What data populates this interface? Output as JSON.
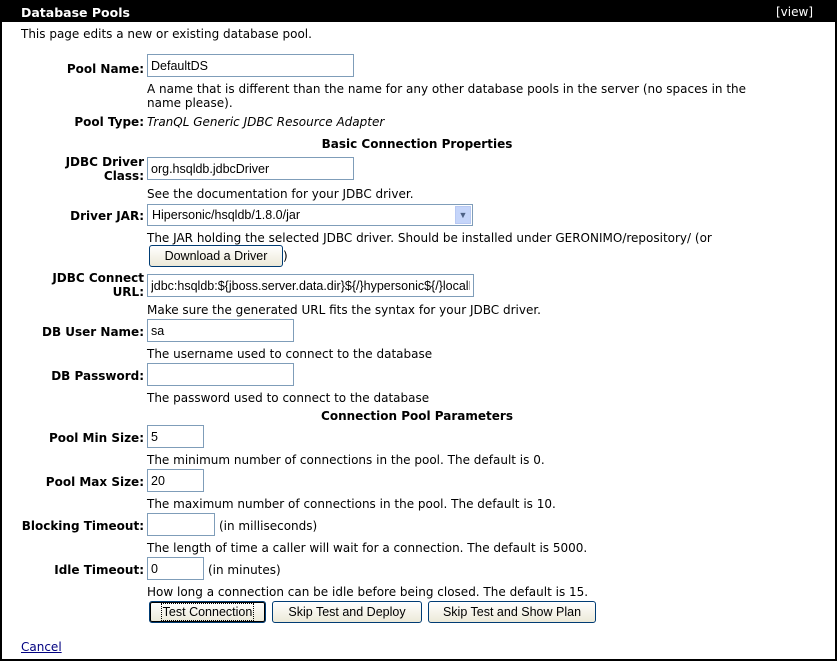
{
  "window": {
    "title": "Database Pools",
    "view_link": "[view]"
  },
  "intro": "This page edits a new or existing database pool.",
  "pool_name": {
    "label": "Pool Name:",
    "value": "DefaultDS",
    "desc1": "A name that is different than the name for any other database pools in the server (no spaces in the",
    "desc2": "name please)."
  },
  "pool_type": {
    "label": "Pool Type:",
    "value": "TranQL Generic JDBC Resource Adapter"
  },
  "sections": {
    "basic": "Basic Connection Properties",
    "pool": "Connection Pool Parameters"
  },
  "driver_class": {
    "label1": "JDBC Driver",
    "label2": "Class:",
    "value": "org.hsqldb.jdbcDriver",
    "desc": "See the documentation for your JDBC driver."
  },
  "driver_jar": {
    "label": "Driver JAR:",
    "selected": "Hipersonic/hsqldb/1.8.0/jar",
    "desc": "The JAR holding the selected JDBC driver. Should be installed under GERONIMO/repository/ (or",
    "download_button": "Download a Driver",
    "close_paren": ")"
  },
  "connect_url": {
    "label1": "JDBC Connect",
    "label2": "URL:",
    "value": "jdbc:hsqldb:${jboss.server.data.dir}${/}hypersonic${/}localDB",
    "desc": "Make sure the generated URL fits the syntax for your JDBC driver."
  },
  "db_user": {
    "label": "DB User Name:",
    "value": "sa",
    "desc": "The username used to connect to the database"
  },
  "db_password": {
    "label": "DB Password:",
    "value": "",
    "desc": "The password used to connect to the database"
  },
  "pool_min": {
    "label": "Pool Min Size:",
    "value": "5",
    "desc": "The minimum number of connections in the pool. The default is 0."
  },
  "pool_max": {
    "label": "Pool Max Size:",
    "value": "20",
    "desc": "The maximum number of connections in the pool. The default is 10."
  },
  "blocking_timeout": {
    "label": "Blocking Timeout:",
    "value": "",
    "unit": "(in milliseconds)",
    "desc": "The length of time a caller will wait for a connection. The default is 5000."
  },
  "idle_timeout": {
    "label": "Idle Timeout:",
    "value": "0",
    "unit": "(in minutes)",
    "desc": "How long a connection can be idle before being closed. The default is 15."
  },
  "actions": {
    "test": "Test Connection",
    "skip_deploy": "Skip Test and Deploy",
    "skip_plan": "Skip Test and Show Plan"
  },
  "cancel": "Cancel"
}
